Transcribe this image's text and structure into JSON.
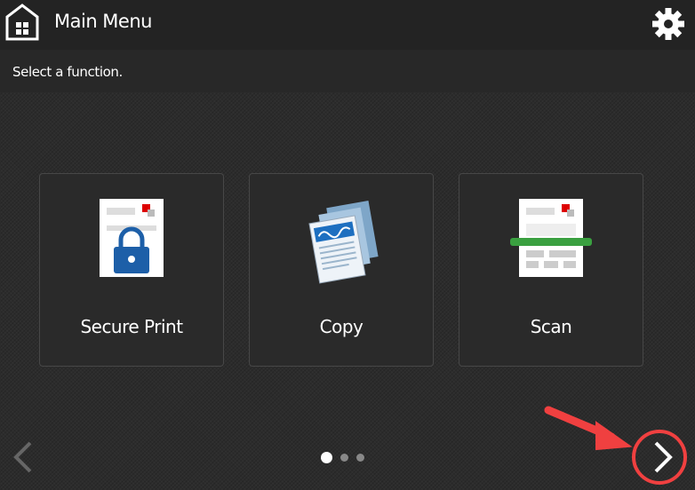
{
  "header": {
    "title": "Main Menu",
    "home_icon": "home-icon",
    "settings_icon": "gear-icon"
  },
  "instruction": "Select a function.",
  "tiles": [
    {
      "label": "Secure Print",
      "icon": "secure-print-icon"
    },
    {
      "label": "Copy",
      "icon": "copy-icon"
    },
    {
      "label": "Scan",
      "icon": "scan-icon"
    }
  ],
  "pagination": {
    "current": 1,
    "total": 3
  },
  "annotation": {
    "color": "#f04040"
  }
}
